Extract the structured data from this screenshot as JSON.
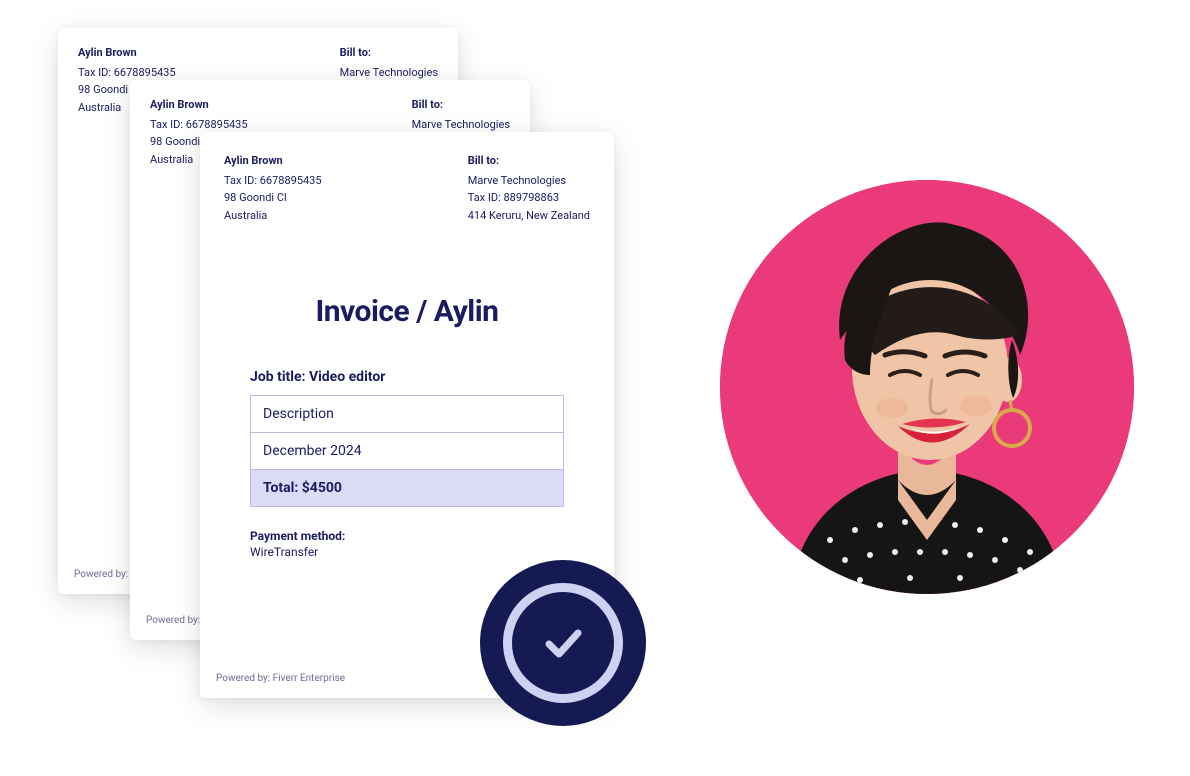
{
  "sender": {
    "name": "Aylin Brown",
    "tax_id": "Tax ID: 6678895435",
    "address_line1": "98 Goondi Cl",
    "address_line2": "Australia"
  },
  "recipient": {
    "label": "Bill to:",
    "company": "Marve Technologies",
    "tax_id": "Tax ID: 889798863",
    "address": "414 Keruru, New Zealand"
  },
  "invoice": {
    "title": "Invoice / Aylin",
    "job_title": "Job title: Video editor",
    "description_label": "Description",
    "period": "December 2024",
    "total": "Total: $4500",
    "payment_method_label": "Payment method:",
    "payment_method_value": "WireTransfer"
  },
  "footer": {
    "powered_by_full": "Powered by: Fiverr Enterprise",
    "powered_by_trunc_mid": "Powered by: Fi",
    "powered_by_trunc_back": "Powered by: Fiv"
  },
  "badge": {
    "name": "success-check"
  },
  "avatar": {
    "name": "aylin-avatar"
  }
}
